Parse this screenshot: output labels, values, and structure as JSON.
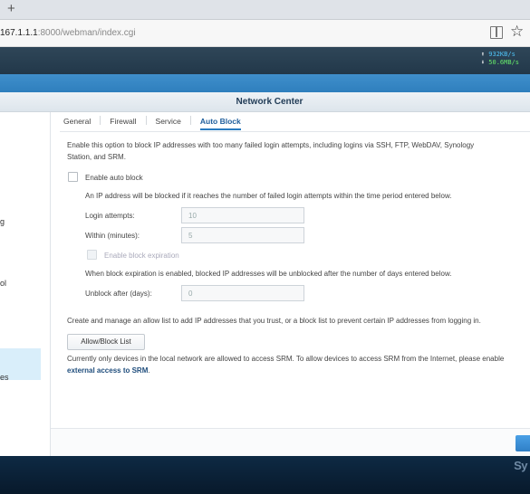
{
  "browser": {
    "new_tab": "+",
    "url_host": "167.1.1.1",
    "url_rest": ":8000/webman/index.cgi",
    "bookmark_icon": "reader-view-icon",
    "star_icon": "favorite-star-icon"
  },
  "status": {
    "upload_arrow": "⬆",
    "upload_speed": "932KB/s",
    "download_arrow": "⬇",
    "download_speed": "50.6MB/s"
  },
  "window": {
    "title": "Network Center"
  },
  "sidebar": {
    "items": [
      "g",
      "ol",
      "es"
    ]
  },
  "tabs": [
    "General",
    "Firewall",
    "Service",
    "Auto Block"
  ],
  "auto_block": {
    "intro_line1": "Enable this option to block IP addresses with too many failed login attempts, including logins via SSH, FTP, WebDAV, Synology",
    "intro_line2": "Station, and SRM.",
    "enable_label": "Enable auto block",
    "desc": "An IP address will be blocked if it reaches the number of failed login attempts within the time period entered below.",
    "login_attempts_label": "Login attempts:",
    "login_attempts_value": "10",
    "within_label": "Within (minutes):",
    "within_value": "5",
    "expiration_label": "Enable block expiration",
    "expiration_desc": "When block expiration is enabled, blocked IP addresses will be unblocked after the number of days entered below.",
    "unblock_label": "Unblock after (days):",
    "unblock_value": "0",
    "allow_desc": "Create and manage an allow list to add IP addresses that you trust, or a block list to prevent certain IP addresses from logging in.",
    "allow_button": "Allow/Block List",
    "srm_desc": "Currently only devices in the local network are allowed to access SRM. To allow devices to access SRM from the Internet, please enable",
    "srm_link": "external access to SRM",
    "srm_period": "."
  },
  "desktop": {
    "logo_text": "Sy"
  }
}
